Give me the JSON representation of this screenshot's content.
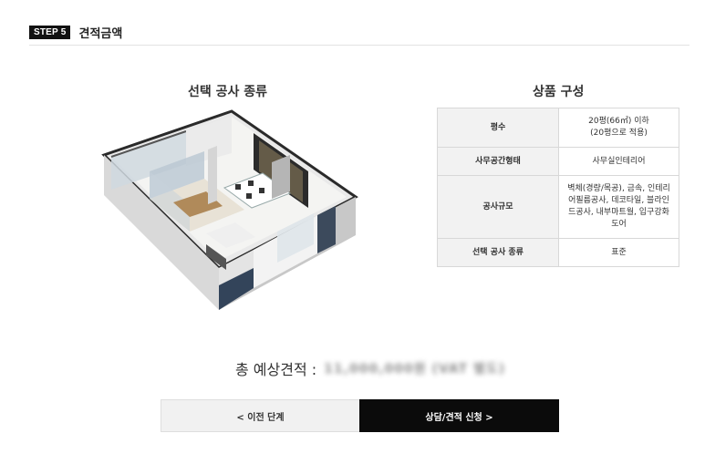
{
  "header": {
    "step_badge": "STEP 5",
    "title": "견적금액"
  },
  "left": {
    "title": "선택 공사 종류"
  },
  "right": {
    "title": "상품 구성",
    "rows": [
      {
        "key": "평수",
        "value_line1": "20평(66㎡) 이하",
        "value_line2": "(20평으로 적용)"
      },
      {
        "key": "사무공간형태",
        "value": "사무실인테리어"
      },
      {
        "key": "공사규모",
        "value_lines": [
          "벽체(경량/목공), 금속, 인테리",
          "어필름공사, 데코타일, 블라인",
          "드공사, 내부마트월, 입구강화",
          "도어"
        ]
      },
      {
        "key": "선택 공사 종류",
        "value": "표준"
      }
    ]
  },
  "estimate": {
    "label": "총 예상견적 :",
    "value_blurred": "11,000,000원 (VAT 별도)"
  },
  "buttons": {
    "prev": "< 이전 단계",
    "next": "상담/견적 신청 >"
  }
}
